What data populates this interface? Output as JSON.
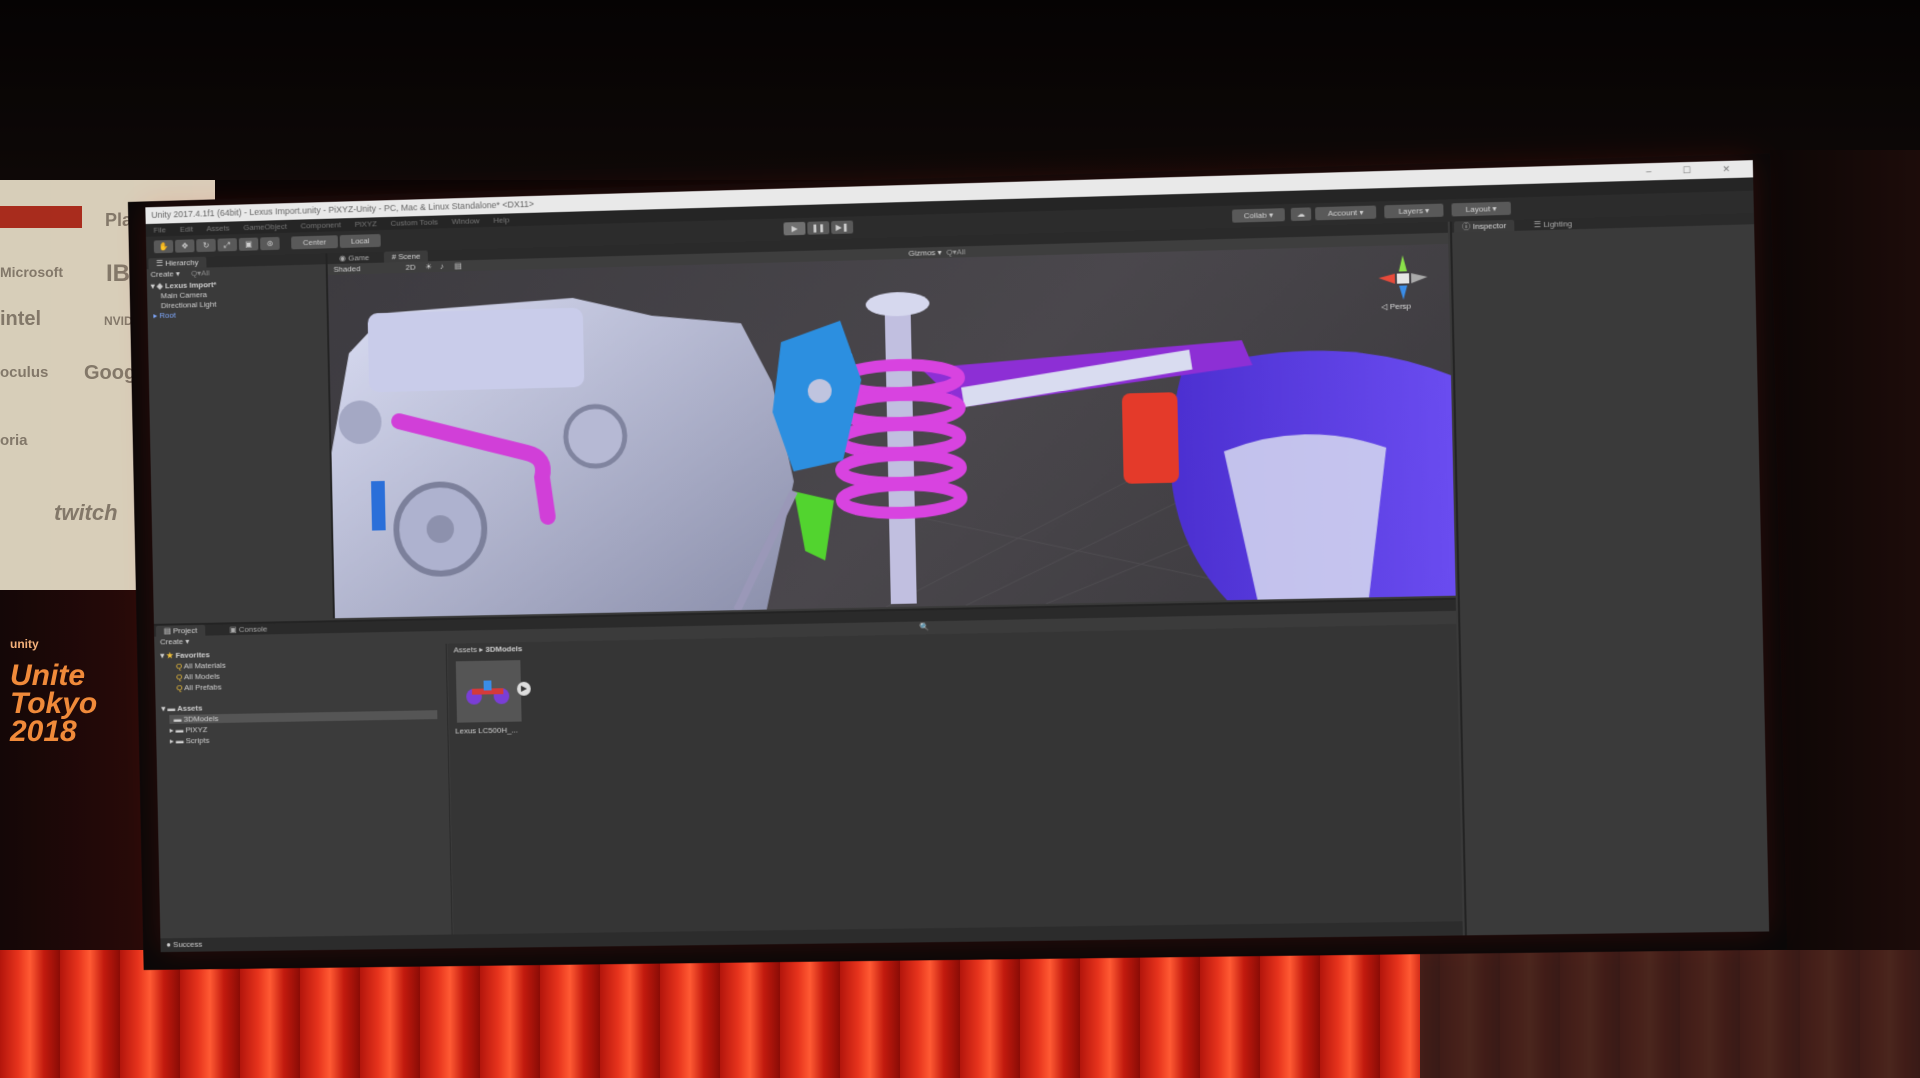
{
  "backdrop": {
    "sponsors": [
      "PlayStation",
      "Microsoft",
      "IBM",
      "intel",
      "NVIDIA",
      "oculus",
      "Google",
      "oria",
      "twitch"
    ],
    "event": {
      "brand": "unity",
      "line1": "Unite",
      "line2": "Tokyo",
      "line3": "2018"
    }
  },
  "window": {
    "title": "Unity 2017.4.1f1 (64bit) - Lexus Import.unity - PiXYZ-Unity - PC, Mac & Linux Standalone* <DX11>",
    "controls": "– ☐ ✕"
  },
  "menu": [
    "File",
    "Edit",
    "Assets",
    "GameObject",
    "Component",
    "PiXYZ",
    "Custom Tools",
    "Window",
    "Help"
  ],
  "toolbar": {
    "pivot": "Center",
    "space": "Local",
    "collab": "Collab ▾",
    "account": "Account ▾",
    "layers": "Layers ▾",
    "layout": "Layout ▾",
    "play": "▶",
    "pause": "❚❚",
    "step": "▶❚"
  },
  "hierarchy": {
    "tab": "Hierarchy",
    "create": "Create ▾",
    "search": "Q▾All",
    "scene": "Lexus Import*",
    "items": [
      "Main Camera",
      "Directional Light",
      "Root"
    ]
  },
  "tabs": {
    "game": "Game",
    "scene": "Scene"
  },
  "scene_toolbar": {
    "shaded": "Shaded",
    "mode2d": "2D",
    "gizmos": "Gizmos ▾",
    "all": "Q▾All"
  },
  "gizmo": {
    "persp": "◁ Persp",
    "x": "x",
    "y": "y",
    "z": "z"
  },
  "inspector": {
    "tab": "Inspector",
    "lighting": "Lighting"
  },
  "project": {
    "tab": "Project",
    "console": "Console",
    "create": "Create ▾",
    "favorites": "Favorites",
    "fav_items": [
      "All Materials",
      "All Models",
      "All Prefabs"
    ],
    "assets": "Assets",
    "folders": [
      "3DModels",
      "PiXYZ",
      "Scripts"
    ],
    "breadcrumb_root": "Assets",
    "breadcrumb_sep": "▸",
    "breadcrumb_current": "3DModels",
    "asset_name": "Lexus LC500H_..."
  },
  "status": "Success"
}
